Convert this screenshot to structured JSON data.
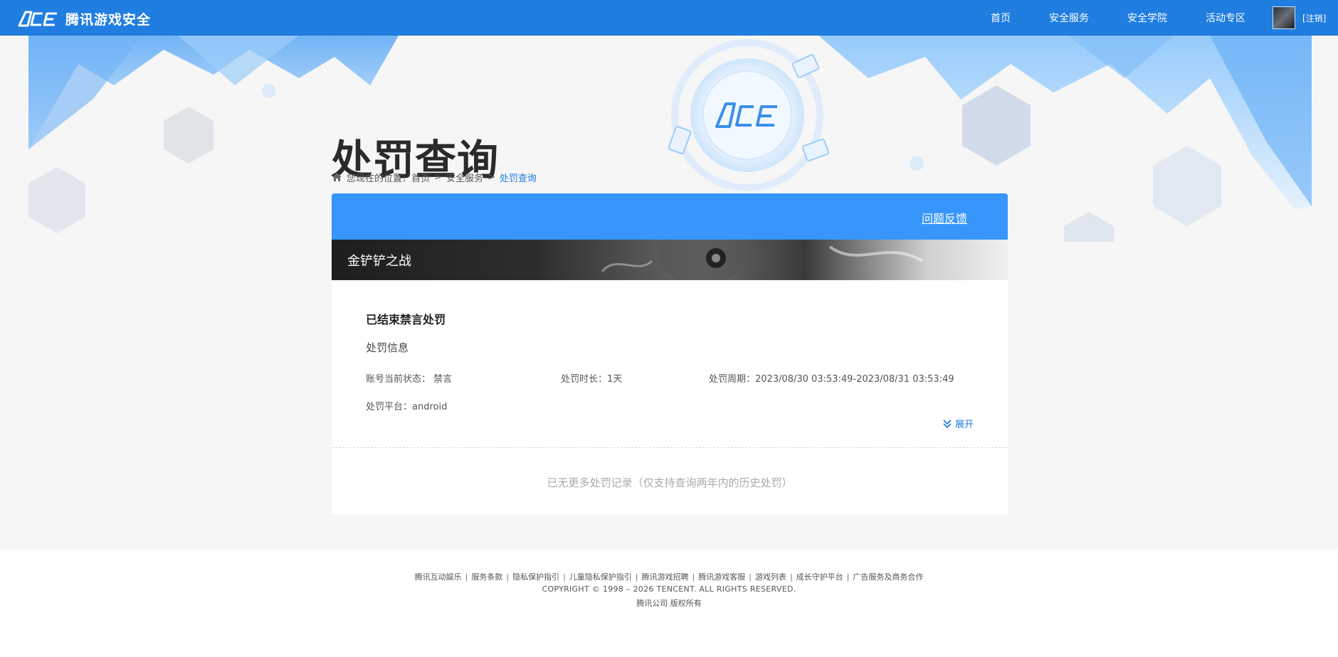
{
  "header": {
    "logo_text": "腾讯游戏安全",
    "nav": [
      {
        "label": "首页"
      },
      {
        "label": "安全服务"
      },
      {
        "label": "安全学院"
      },
      {
        "label": "活动专区"
      }
    ],
    "logout_label": "[注销]"
  },
  "hero": {
    "title": "处罚查询"
  },
  "breadcrumb": {
    "prefix": "您现在的位置：",
    "items": [
      "首页",
      "安全服务",
      "处罚查询"
    ],
    "separator": ">"
  },
  "card": {
    "feedback_label": "问题反馈",
    "game_name": "金铲铲之战",
    "record": {
      "title": "已结束禁言处罚",
      "section_label": "处罚信息",
      "status": "账号当前状态：  禁言",
      "duration": "处罚时长：1天",
      "period": "处罚周期：2023/08/30 03:53:49-2023/08/31 03:53:49",
      "platform": "处罚平台：android",
      "expand_label": "展开"
    },
    "no_more_text": "已无更多处罚记录（仅支持查询两年内的历史处罚）"
  },
  "footer": {
    "links": [
      "腾讯互动娱乐",
      "服务条款",
      "隐私保护指引",
      "儿童隐私保护指引",
      "腾讯游戏招聘",
      "腾讯游戏客服",
      "游戏列表",
      "成长守护平台",
      "广告服务及商务合作"
    ],
    "copyright": "COPYRIGHT © 1998 – 2026 TENCENT. ALL RIGHTS RESERVED.",
    "company": "腾讯公司 版权所有"
  },
  "colors": {
    "brand_blue": "#1f7ee0",
    "card_header_blue": "#3796fb"
  },
  "icons": {
    "home": "home-icon",
    "expand": "double-chevron-down-icon"
  }
}
